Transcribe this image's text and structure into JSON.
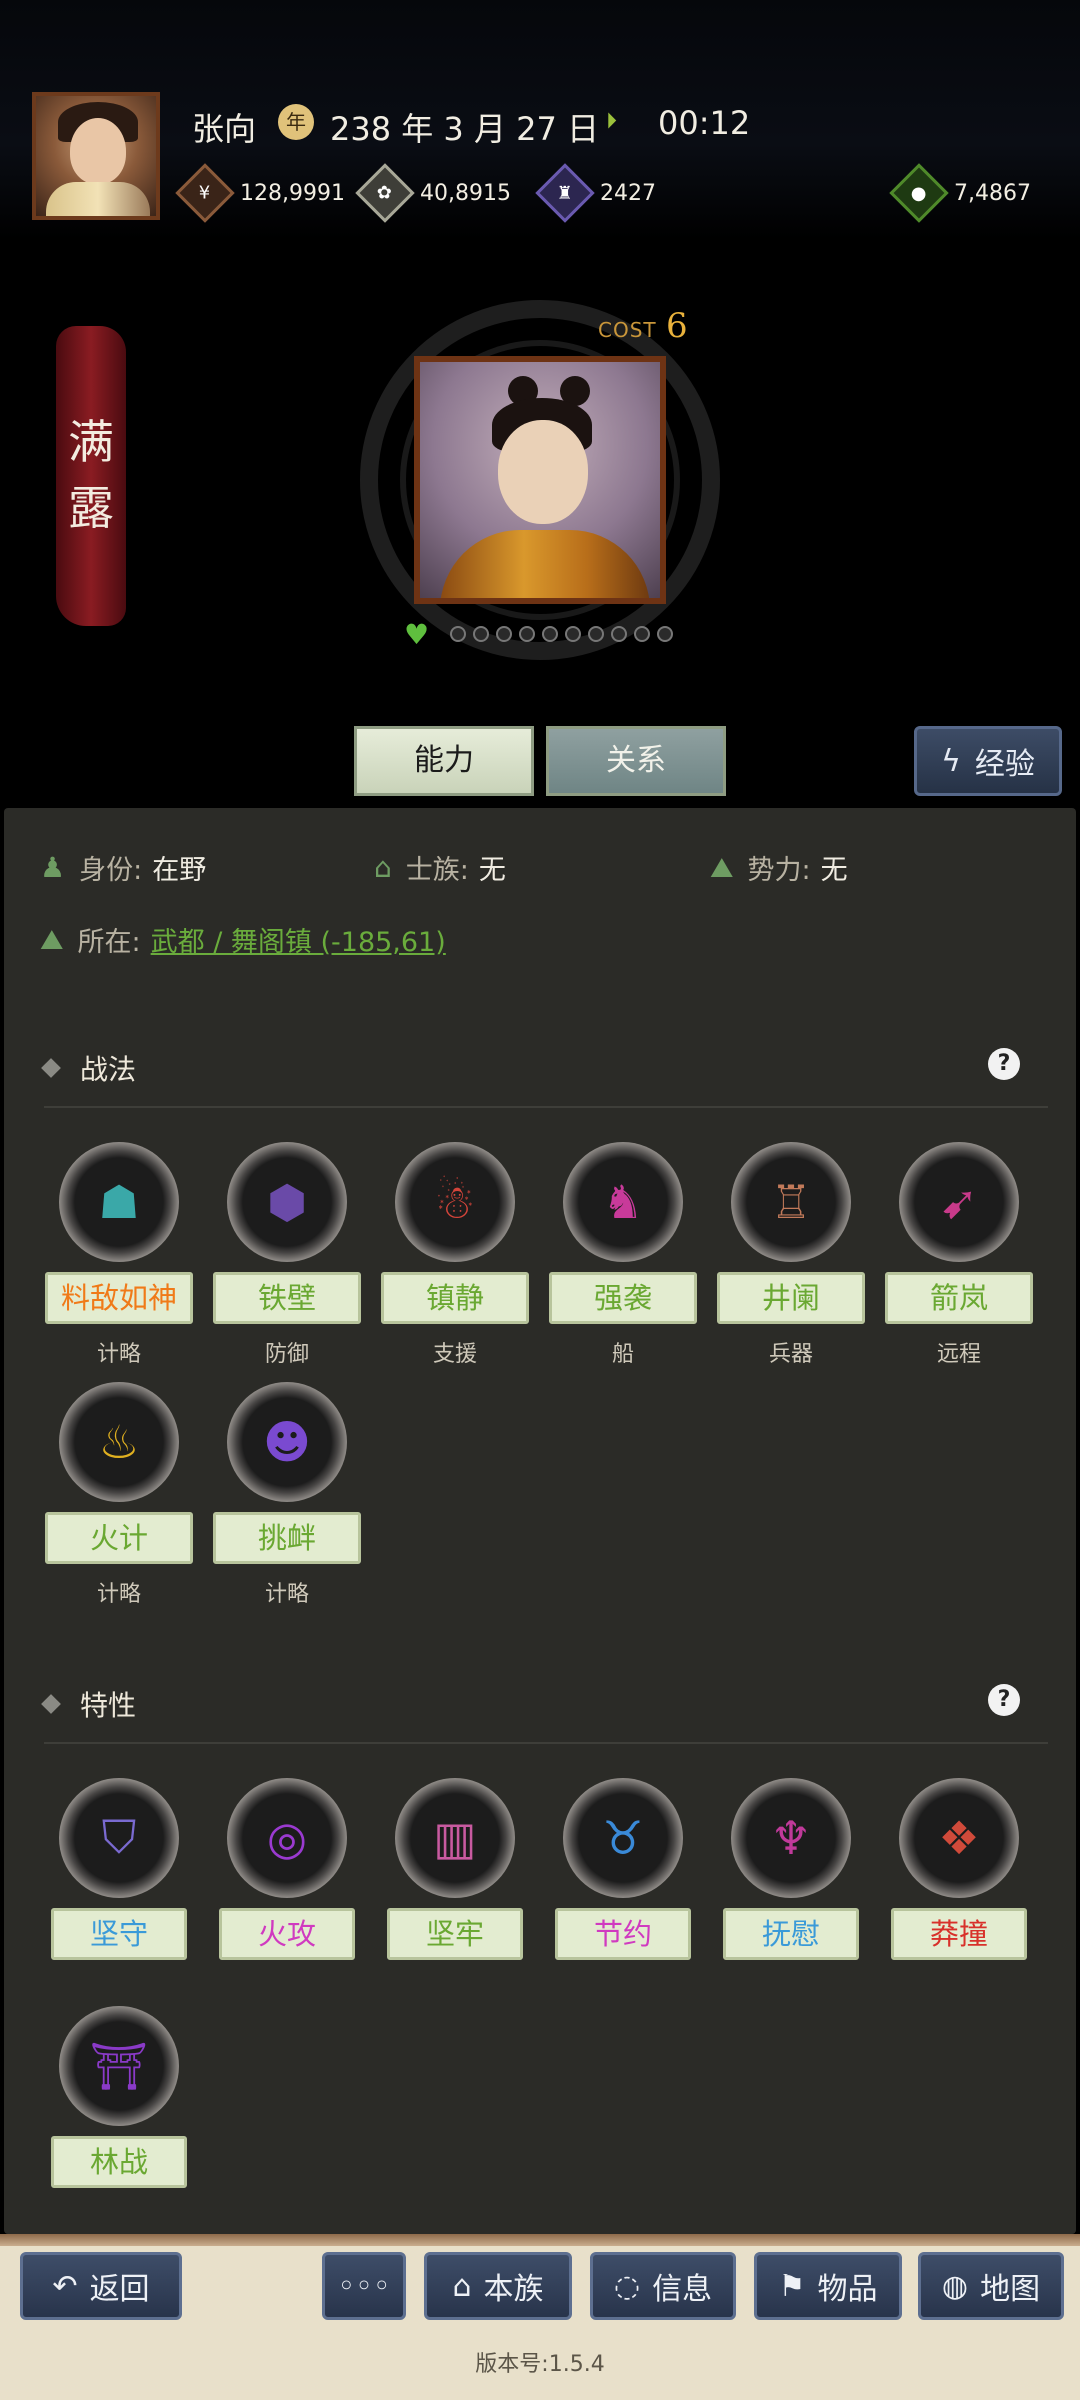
{
  "header": {
    "name": "张向",
    "date": "238 年 3 月 27 日",
    "time": "00:12",
    "resources": [
      {
        "icon": "money-icon",
        "value": "128,9991",
        "color": "#8a5a3a"
      },
      {
        "icon": "grain-icon",
        "value": "40,8915",
        "color": "#9a9a8a"
      },
      {
        "icon": "soldier-icon",
        "value": "2427",
        "color": "#6a5ab0"
      },
      {
        "icon": "bag-icon",
        "value": "7,4867",
        "color": "#4f8a2a"
      }
    ]
  },
  "character": {
    "given_name_1": "满",
    "given_name_2": "露",
    "cost_label": "COST",
    "cost_value": "6"
  },
  "tabs": {
    "ability": "能力",
    "relation": "关系",
    "exp": "经验"
  },
  "info": {
    "identity_label": "身份:",
    "identity_value": "在野",
    "clan_label": "士族:",
    "clan_value": "无",
    "faction_label": "势力:",
    "faction_value": "无",
    "location_label": "所在:",
    "location_value": "武都 / 舞阁镇 (-185,61)"
  },
  "tactics": {
    "title": "战法",
    "items": [
      {
        "name": "料敌如神",
        "category": "计略",
        "color": "#f07a18",
        "icon": "wisdom-icon",
        "icon_color": "#3aa8a8"
      },
      {
        "name": "铁壁",
        "category": "防御",
        "color": "#6aa832",
        "icon": "shield-grid-icon",
        "icon_color": "#6a4aa8"
      },
      {
        "name": "镇静",
        "category": "支援",
        "color": "#6aa832",
        "icon": "calm-figure-icon",
        "icon_color": "#d2443a"
      },
      {
        "name": "强袭",
        "category": "船",
        "color": "#6aa832",
        "icon": "raid-icon",
        "icon_color": "#c83a9a"
      },
      {
        "name": "井阑",
        "category": "兵器",
        "color": "#6aa832",
        "icon": "tower-icon",
        "icon_color": "#c27a5a"
      },
      {
        "name": "箭岚",
        "category": "远程",
        "color": "#6aa832",
        "icon": "arrow-storm-icon",
        "icon_color": "#c83a8a"
      },
      {
        "name": "火计",
        "category": "计略",
        "color": "#6aa832",
        "icon": "fire-icon",
        "icon_color": "#e0b020"
      },
      {
        "name": "挑衅",
        "category": "计略",
        "color": "#6aa832",
        "icon": "provoke-icon",
        "icon_color": "#7a4ad0"
      }
    ]
  },
  "traits": {
    "title": "特性",
    "items": [
      {
        "name": "坚守",
        "color": "#3a9ad8",
        "icon": "shields-icon",
        "icon_color": "#7a6ad0"
      },
      {
        "name": "火攻",
        "color": "#d03ac0",
        "icon": "fire-ring-icon",
        "icon_color": "#9a3ad0"
      },
      {
        "name": "坚牢",
        "color": "#6aa832",
        "icon": "barrel-icon",
        "icon_color": "#c85aa0"
      },
      {
        "name": "节约",
        "color": "#d03ac0",
        "icon": "piggy-bank-icon",
        "icon_color": "#3a8ad8"
      },
      {
        "name": "抚慰",
        "color": "#3a9ad8",
        "icon": "cheers-icon",
        "icon_color": "#c03a9a"
      },
      {
        "name": "莽撞",
        "color": "#d8302a",
        "icon": "rampage-icon",
        "icon_color": "#d04a3a"
      },
      {
        "name": "林战",
        "color": "#6aa832",
        "icon": "forest-icon",
        "icon_color": "#8a3ac8"
      }
    ]
  },
  "bottom_nav": {
    "back": "返回",
    "more": "◦◦◦",
    "clan": "本族",
    "info": "信息",
    "items": "物品",
    "map": "地图",
    "version": "版本号:1.5.4"
  }
}
